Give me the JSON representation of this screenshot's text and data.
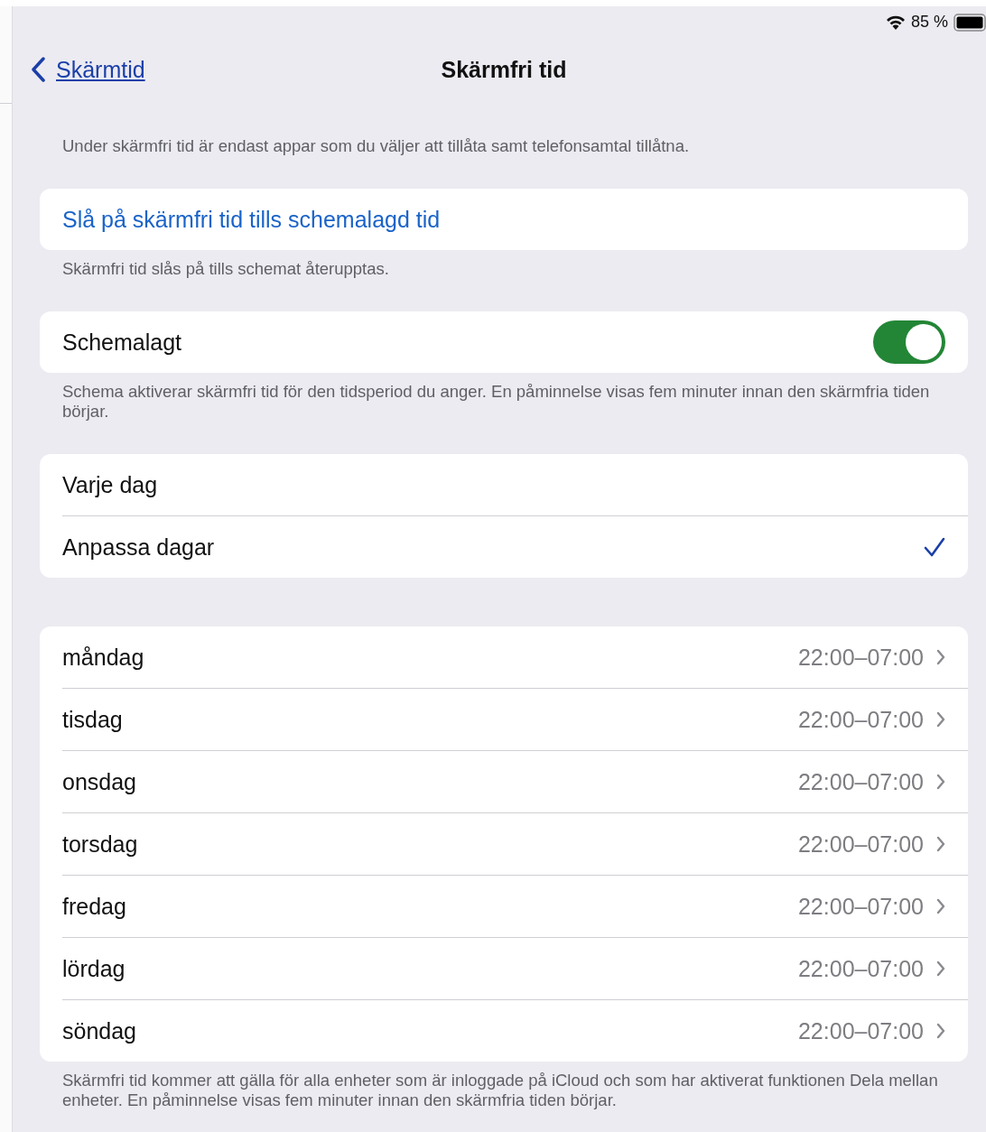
{
  "status_bar": {
    "battery_text": "85 %"
  },
  "nav": {
    "back_label": "Skärmtid",
    "title": "Skärmfri tid"
  },
  "intro": "Under skärmfri tid är endast appar som du väljer att tillåta samt telefonsamtal tillåtna.",
  "action": {
    "label": "Slå på skärmfri tid tills schemalagd tid",
    "footer": "Skärmfri tid slås på tills schemat återupptas."
  },
  "schedule": {
    "label": "Schemalagt",
    "on": true,
    "footer": "Schema aktiverar skärmfri tid för den tidsperiod du anger. En påminnelse visas fem minuter innan den skärmfria tiden börjar."
  },
  "mode_options": [
    {
      "label": "Varje dag",
      "selected": false
    },
    {
      "label": "Anpassa dagar",
      "selected": true
    }
  ],
  "days": [
    {
      "day": "måndag",
      "time": "22:00–07:00"
    },
    {
      "day": "tisdag",
      "time": "22:00–07:00"
    },
    {
      "day": "onsdag",
      "time": "22:00–07:00"
    },
    {
      "day": "torsdag",
      "time": "22:00–07:00"
    },
    {
      "day": "fredag",
      "time": "22:00–07:00"
    },
    {
      "day": "lördag",
      "time": "22:00–07:00"
    },
    {
      "day": "söndag",
      "time": "22:00–07:00"
    }
  ],
  "footer": "Skärmfri tid kommer att gälla för alla enheter som är inloggade på iCloud och som har aktiverat funktionen Dela mellan enheter. En påminnelse visas fem minuter innan den skärmfria tiden börjar."
}
